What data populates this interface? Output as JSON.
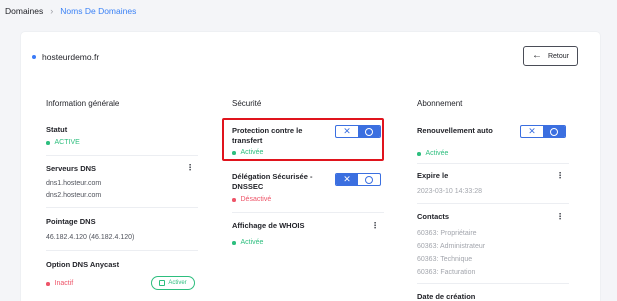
{
  "breadcrumb": {
    "root": "Domaines",
    "current": "Noms De Domaines"
  },
  "domain": {
    "name": "hosteurdemo.fr"
  },
  "actions": {
    "back_label": "Retour"
  },
  "info": {
    "title": "Information générale",
    "statut": {
      "label": "Statut",
      "value": "ACTIVE"
    },
    "dns": {
      "label": "Serveurs DNS",
      "servers": [
        "dns1.hosteur.com",
        "dns2.hosteur.com"
      ]
    },
    "pointage": {
      "label": "Pointage DNS",
      "value": "46.182.4.120 (46.182.4.120)"
    },
    "anycast": {
      "label": "Option DNS Anycast",
      "value": "Inactif",
      "button": "Activer"
    }
  },
  "security": {
    "title": "Sécurité",
    "transfer": {
      "label": "Protection contre le transfert",
      "status": "Activée",
      "toggle": "on"
    },
    "dnssec": {
      "label": "Délégation Sécurisée - DNSSEC",
      "status": "Désactivé",
      "toggle": "off"
    },
    "whois": {
      "label": "Affichage de WHOIS",
      "status": "Activée"
    }
  },
  "subscription": {
    "title": "Abonnement",
    "renewal": {
      "label": "Renouvellement auto",
      "status": "Activée",
      "toggle": "on"
    },
    "expire": {
      "label": "Expire le",
      "value": "2023-03-10 14:33:28"
    },
    "contacts": {
      "label": "Contacts",
      "items": [
        "60363: Propriétaire",
        "60363: Administrateur",
        "60363: Technique",
        "60363: Facturation"
      ]
    },
    "creation": {
      "label": "Date de création"
    }
  },
  "colors": {
    "accent": "#3b6fe0",
    "success": "#2dbe7e",
    "danger": "#ee5468",
    "highlight": "#e0141d"
  }
}
